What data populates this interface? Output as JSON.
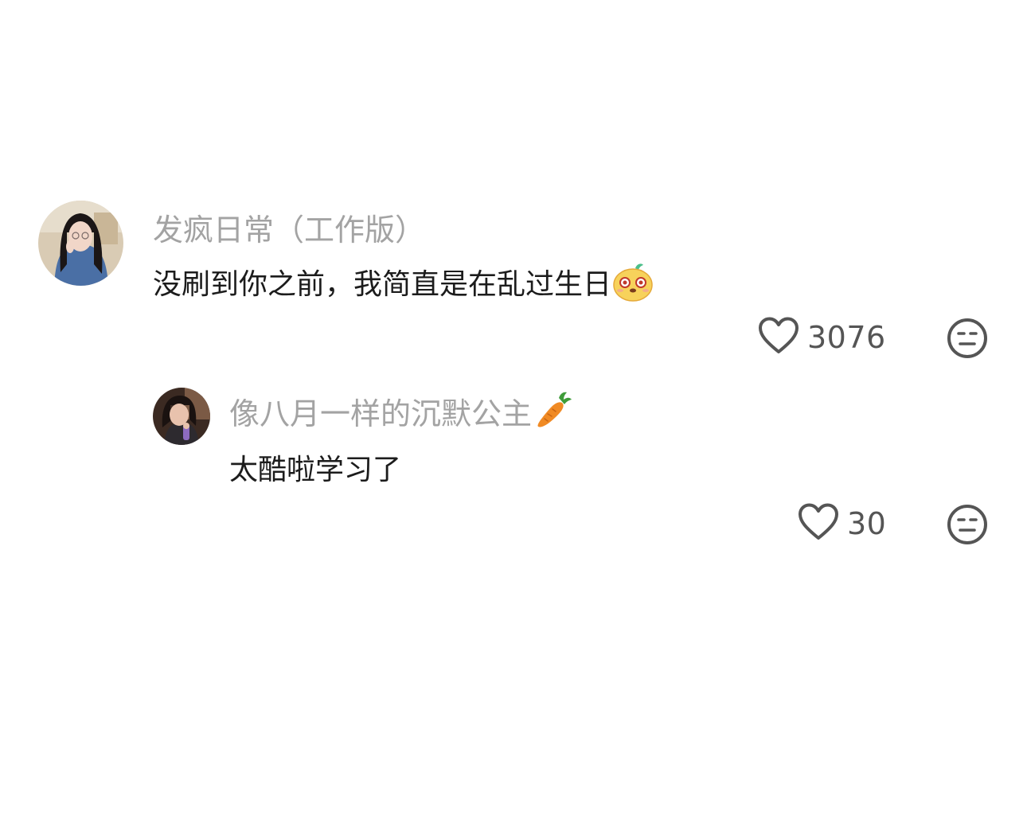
{
  "comments": [
    {
      "username": "发疯日常（工作版）",
      "text": "没刷到你之前，我简直是在乱过生日",
      "text_emoji": "sticker-face-emoji",
      "likes": "3076",
      "avatar": "user-avatar-photo"
    }
  ],
  "replies": [
    {
      "username": "像八月一样的沉默公主",
      "username_emoji": "carrot-emoji",
      "text": "太酷啦学习了",
      "likes": "30",
      "avatar": "user-avatar-photo"
    }
  ],
  "icons": {
    "like": "heart-outline-icon",
    "dislike": "unamused-face-icon"
  },
  "colors": {
    "username": "#a3a3a3",
    "text": "#1c1c1c",
    "action": "#555555"
  }
}
